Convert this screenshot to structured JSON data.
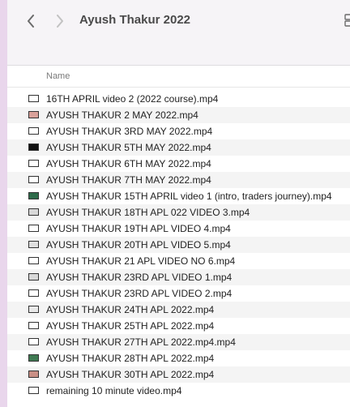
{
  "window": {
    "title": "Ayush Thakur 2022"
  },
  "header": {
    "name_label": "Name"
  },
  "icons": {
    "back": "chevron-left-icon",
    "forward": "chevron-right-icon",
    "view": "view-options-icon",
    "file": "video-thumbnail-icon"
  },
  "colors": {
    "sidebar_accent": "#e9d6ec",
    "toolbar_bg": "#f6f4f7",
    "alt_row": "#f4f4f4"
  },
  "files": [
    {
      "name": "16TH APRIL video 2 (2022 course).mp4",
      "thumb_color": "#ffffff"
    },
    {
      "name": "AYUSH THAKUR 2 MAY 2022.mp4",
      "thumb_color": "#d9a19a"
    },
    {
      "name": "AYUSH THAKUR 3RD MAY 2022.mp4",
      "thumb_color": "#ffffff"
    },
    {
      "name": "AYUSH THAKUR 5TH MAY 2022.mp4",
      "thumb_color": "#111111"
    },
    {
      "name": "AYUSH THAKUR 6TH MAY 2022.mp4",
      "thumb_color": "#ffffff"
    },
    {
      "name": "AYUSH THAKUR 7TH MAY 2022.mp4",
      "thumb_color": "#ffffff"
    },
    {
      "name": "AYUSH THAKUR 15TH APRIL video 1 (intro, traders journey).mp4",
      "thumb_color": "#2e6b4a"
    },
    {
      "name": "AYUSH THAKUR 18TH APL 022 VIDEO 3.mp4",
      "thumb_color": "#d8d8d8"
    },
    {
      "name": "AYUSH THAKUR 19TH APL VIDEO 4.mp4",
      "thumb_color": "#ffffff"
    },
    {
      "name": "AYUSH THAKUR 20TH APL VIDEO 5.mp4",
      "thumb_color": "#e0e0e0"
    },
    {
      "name": "AYUSH THAKUR 21 APL VIDEO NO 6.mp4",
      "thumb_color": "#ffffff"
    },
    {
      "name": "AYUSH THAKUR 23RD APL VIDEO 1.mp4",
      "thumb_color": "#d8d8d8"
    },
    {
      "name": "AYUSH THAKUR 23RD APL VIDEO 2.mp4",
      "thumb_color": "#ffffff"
    },
    {
      "name": "AYUSH THAKUR 24TH APL 2022.mp4",
      "thumb_color": "#e8e8e8"
    },
    {
      "name": "AYUSH THAKUR 25TH APL 2022.mp4",
      "thumb_color": "#ffffff"
    },
    {
      "name": "AYUSH THAKUR 27TH APL 2022.mp4.mp4",
      "thumb_color": "#ffffff"
    },
    {
      "name": "AYUSH THAKUR 28TH APL 2022.mp4",
      "thumb_color": "#3f7a52"
    },
    {
      "name": "AYUSH THAKUR 30TH APL 2022.mp4",
      "thumb_color": "#c98f85"
    },
    {
      "name": "remaining 10 minute video.mp4",
      "thumb_color": "#ffffff"
    }
  ]
}
